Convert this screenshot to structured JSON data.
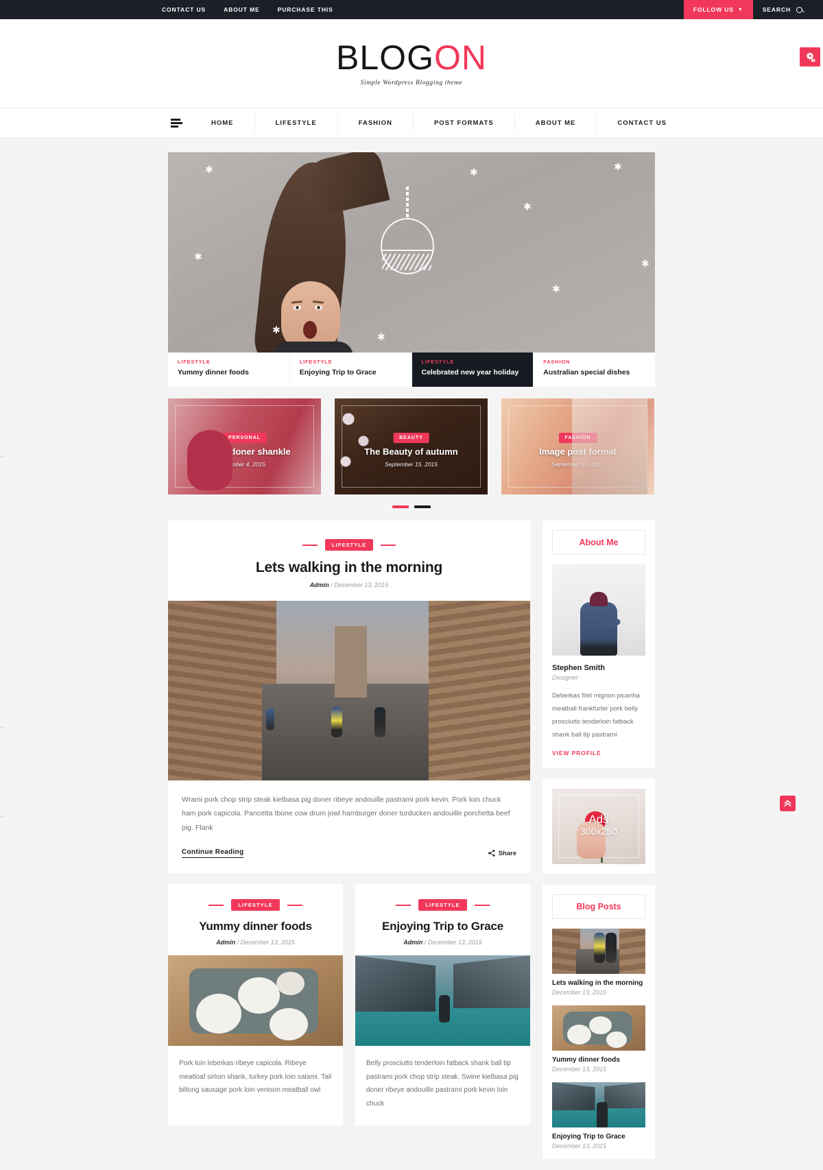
{
  "topbar": {
    "links": [
      "CONTACT US",
      "ABOUT ME",
      "PURCHASE THIS"
    ],
    "follow_label": "FOLLOW US",
    "search_label": "SEARCH",
    "bg_color": "#1b2028",
    "accent_color": "#f2385a"
  },
  "header": {
    "logo_part1": "BLOG",
    "logo_part2": "ON",
    "tagline": "Simple Wordpress Blogging theme",
    "settings_icon": "gear-icon"
  },
  "nav": {
    "menu_icon": "hamburger-icon",
    "items": [
      "HOME",
      "LIFESTYLE",
      "FASHION",
      "POST FORMATS",
      "ABOUT ME",
      "CONTACT US"
    ]
  },
  "slider": {
    "captions": [
      {
        "category": "LIFESTYLE",
        "title": "Yummy dinner foods",
        "active": false
      },
      {
        "category": "LIFESTYLE",
        "title": "Enjoying Trip to Grace",
        "active": false
      },
      {
        "category": "LIFESTYLE",
        "title": "Celebrated new year holiday",
        "active": true
      },
      {
        "category": "FASHION",
        "title": "Australian special dishes",
        "active": false
      }
    ]
  },
  "features": [
    {
      "badge": "PERSONAL",
      "title": "Ribeye doner shankle",
      "date": "October 4, 2015"
    },
    {
      "badge": "BEAUTY",
      "title": "The Beauty of autumn",
      "date": "September 15, 2015"
    },
    {
      "badge": "FASHION",
      "title": "Image post format",
      "date": "September 15, 2015"
    }
  ],
  "pagination": {
    "total": 2,
    "active_index": 0
  },
  "posts": [
    {
      "category": "LIFESTYLE",
      "title": "Lets walking in the morning",
      "author": "Admin",
      "date": "December 13, 2015",
      "excerpt": "Wrami pork chop strip steak kielbasa pig doner ribeye andouille pastrami pork kevin. Pork loin chuck ham pork capicola. Pancetta tbone cow drum jowl hamburger doner turducken andouille porchetta beef pig. Flank",
      "continue_label": "Continue Reading",
      "share_label": "Share"
    },
    {
      "category": "LIFESTYLE",
      "title": "Yummy dinner foods",
      "author": "Admin",
      "date": "December 13, 2015",
      "excerpt": "Pork loin leberkas ribeye capicola. Ribeye meatloaf sirloin shank, turkey pork loin salami. Tail biltong sausage pork loin venison meatball owl"
    },
    {
      "category": "LIFESTYLE",
      "title": "Enjoying Trip to Grace",
      "author": "Admin",
      "date": "December 13, 2015",
      "excerpt": "Belly prosciutto tenderloin fatback shank ball tip pastrami pork chop strip steak. Swine kielbasa pig doner ribeye andouille pastrami pork kevin loin chuck"
    }
  ],
  "sidebar": {
    "about": {
      "title_part1": "About ",
      "title_part2": "Me",
      "name": "Stephen Smith",
      "role": "Designer",
      "text": "Deberkas filet mignon picanha meatball frankfurter pork belly prosciutto tenderloin fatback shank ball tip pastrami",
      "link_label": "VIEW PROFILE"
    },
    "ads": {
      "line1": "Ads",
      "line2": "300x250"
    },
    "blog_posts": {
      "title_part1": "Blog ",
      "title_part2": "Posts",
      "items": [
        {
          "title": "Lets walking in the morning",
          "date": "December 13, 2015"
        },
        {
          "title": "Yummy dinner foods",
          "date": "December 13, 2015"
        },
        {
          "title": "Enjoying Trip to Grace",
          "date": "December 13, 2015"
        }
      ]
    }
  },
  "to_top": {
    "icon": "chevron-double-up-icon"
  }
}
